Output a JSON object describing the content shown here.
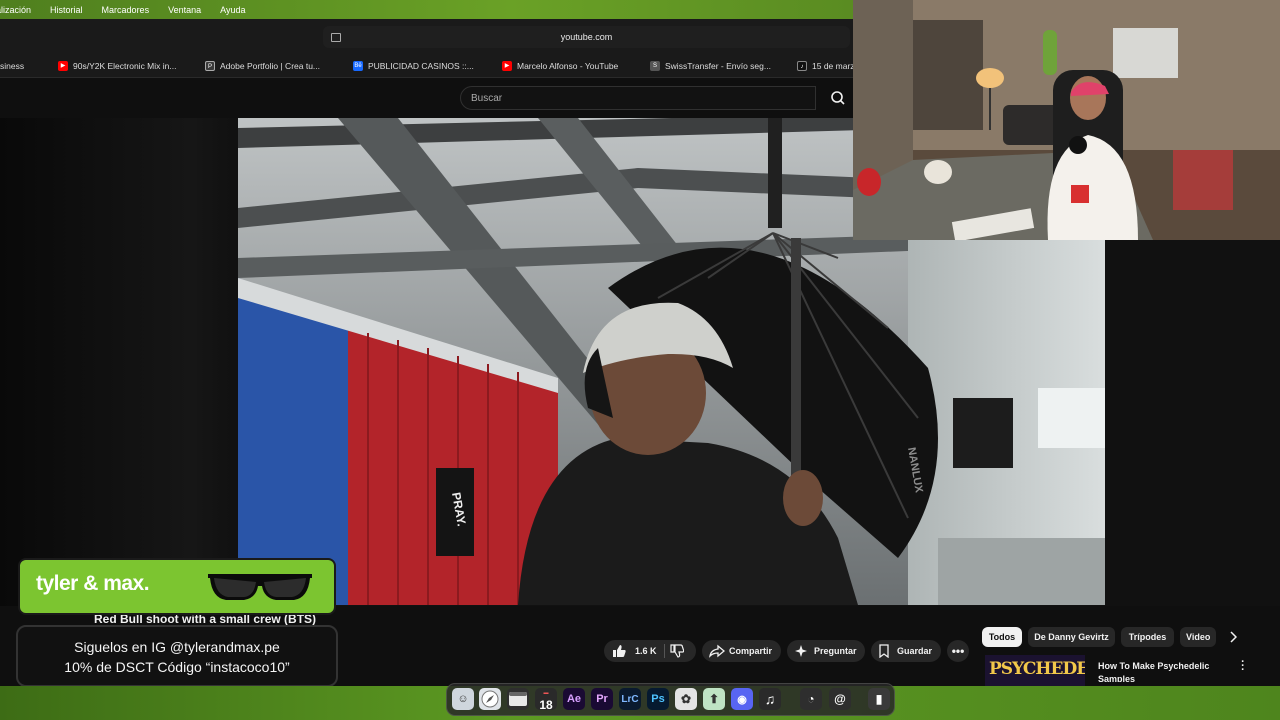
{
  "menubar": {
    "items": [
      "alización",
      "Historial",
      "Marcadores",
      "Ventana",
      "Ayuda"
    ]
  },
  "browser": {
    "url": "youtube.com"
  },
  "bookmarks": [
    {
      "label": "siness",
      "icon": "none-icon",
      "color": ""
    },
    {
      "label": "90s/Y2K Electronic Mix in...",
      "icon": "youtube-icon",
      "color": "#ff0000"
    },
    {
      "label": "Adobe Portfolio | Crea tu...",
      "icon": "adobe-portfolio-icon",
      "color": "#3a3a3a"
    },
    {
      "label": "PUBLICIDAD CASINOS ::...",
      "icon": "behance-icon",
      "color": "#1769ff"
    },
    {
      "label": "Marcelo Alfonso - YouTube",
      "icon": "youtube-icon",
      "color": "#ff0000"
    },
    {
      "label": "SwissTransfer - Envío seg...",
      "icon": "swisstransfer-icon",
      "color": "#444"
    },
    {
      "label": "15 de marz",
      "icon": "tiktok-icon",
      "color": "#111"
    }
  ],
  "youtube": {
    "search_placeholder": "Buscar",
    "video_title": "Red Bull shoot with a small crew (BTS)",
    "likes": "1.6 K",
    "share_label": "Compartir",
    "ask_label": "Preguntar",
    "save_label": "Guardar",
    "chips": [
      "Todos",
      "De Danny Gevirtz",
      "Trípodes",
      "Video"
    ],
    "rec_title": "How To Make Psychedelic Samples",
    "rec_thumb_text": "PSYCHEDELIC"
  },
  "video_scene": {
    "banner_pray": "PRAY.",
    "umbrella_text": "NANLUX"
  },
  "overlay": {
    "brand": "tyler & max.",
    "line1": "Siguelos en IG @tylerandmax.pe",
    "line2": "10% de DSCT Código “instacoco10”",
    "color": "#7cc530"
  },
  "dock": {
    "calendar_day": "18",
    "apps": [
      "Ae",
      "Pr",
      "LrC",
      "Ps"
    ]
  }
}
